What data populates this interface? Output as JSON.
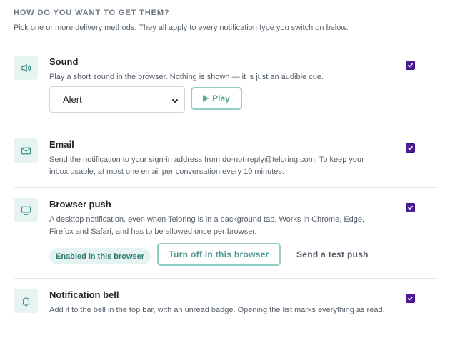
{
  "section": {
    "heading": "HOW DO YOU WANT TO GET THEM?",
    "subtitle": "Pick one or more delivery methods. They all apply to every notification type you switch on below."
  },
  "methods": {
    "sound": {
      "icon": "speaker-icon",
      "title": "Sound",
      "description": "Play a short sound in the browser. Nothing is shown — it is just an audible cue.",
      "checked": true,
      "select_value": "Alert",
      "play_label": "Play"
    },
    "email": {
      "icon": "mail-icon",
      "title": "Email",
      "description": "Send the notification to your sign-in address from do-not-reply@teloring.com. To keep your inbox usable, at most one email per conversation every 10 minutes.",
      "checked": true
    },
    "push": {
      "icon": "monitor-icon",
      "title": "Browser push",
      "description": "A desktop notification, even when Teloring is in a background tab. Works in Chrome, Edge, Firefox and Safari, and has to be allowed once per browser.",
      "checked": true,
      "status_badge": "Enabled in this browser",
      "turn_off_label": "Turn off in this browser",
      "test_label": "Send a test push"
    },
    "bell": {
      "icon": "bell-icon",
      "title": "Notification bell",
      "description": "Add it to the bell in the top bar, with an unread badge. Opening the list marks everything as read.",
      "checked": true
    }
  },
  "colors": {
    "accent": "#4c9f95",
    "accent_light": "#e5f3f1",
    "checkbox": "#4c1d95"
  }
}
